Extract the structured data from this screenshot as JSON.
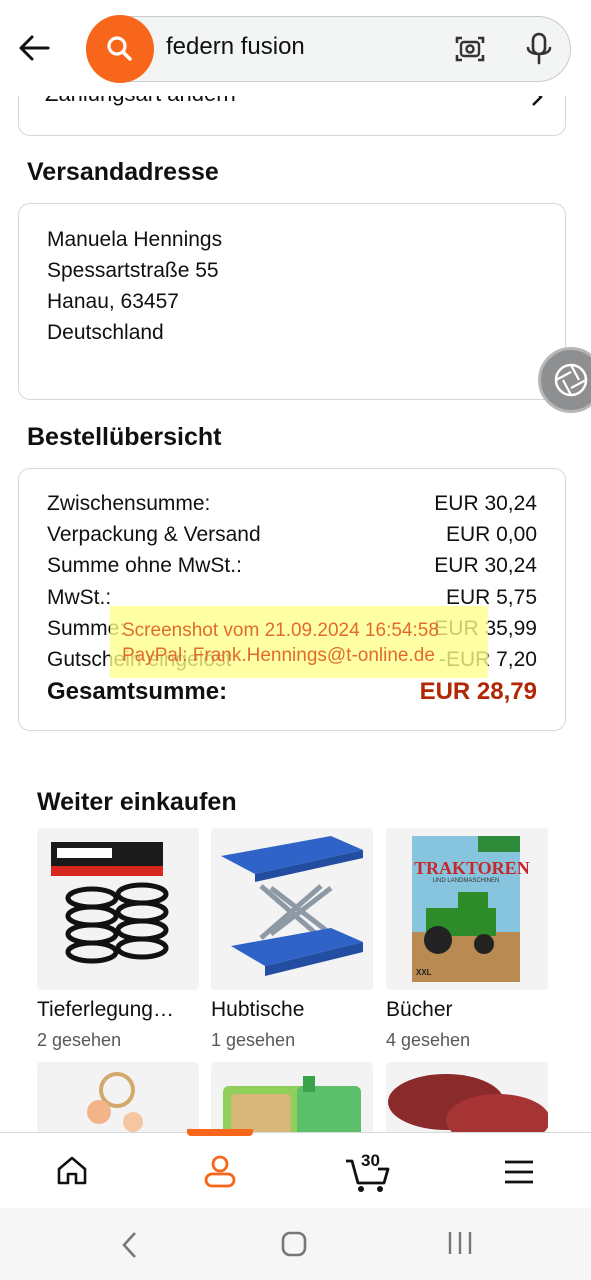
{
  "search": {
    "query": "federn fusion"
  },
  "payment": {
    "label": "Zahlungsart ändern"
  },
  "shipping": {
    "title": "Versandadresse",
    "lines": [
      "Manuela Hennings",
      "Spessartstraße 55",
      "Hanau, 63457",
      "Deutschland"
    ]
  },
  "summary": {
    "title": "Bestellübersicht",
    "rows": [
      {
        "label": "Zwischensumme:",
        "value": "EUR 30,24"
      },
      {
        "label": "Verpackung & Versand",
        "value": "EUR 0,00"
      },
      {
        "label": "Summe ohne MwSt.:",
        "value": "EUR 30,24"
      },
      {
        "label": "MwSt.:",
        "value": "EUR 5,75"
      },
      {
        "label": "Summe:",
        "value": "EUR 35,99"
      },
      {
        "label": "Gutschein eingelöst",
        "value": "-EUR 7,20"
      }
    ],
    "total_label": "Gesamtsumme:",
    "total_value": "EUR 28,79"
  },
  "watermark": {
    "line1": "Screenshot vom 21.09.2024 16:54:58",
    "line2": "PayPal: Frank.Hennings@t-online.de"
  },
  "continue_shopping": {
    "title": "Weiter einkaufen",
    "items": [
      {
        "label": "Tieferlegung…",
        "sub": "2 gesehen"
      },
      {
        "label": "Hubtische",
        "sub": "1 gesehen"
      },
      {
        "label": "Bücher",
        "sub": "4 gesehen"
      }
    ],
    "book_title": "TRAKTOREN",
    "book_subtitle": "UND LANDMASCHINEN",
    "book_badge": "XXL"
  },
  "nav": {
    "cart_count": "30"
  },
  "colors": {
    "accent": "#f7661b",
    "price": "#b12704"
  }
}
